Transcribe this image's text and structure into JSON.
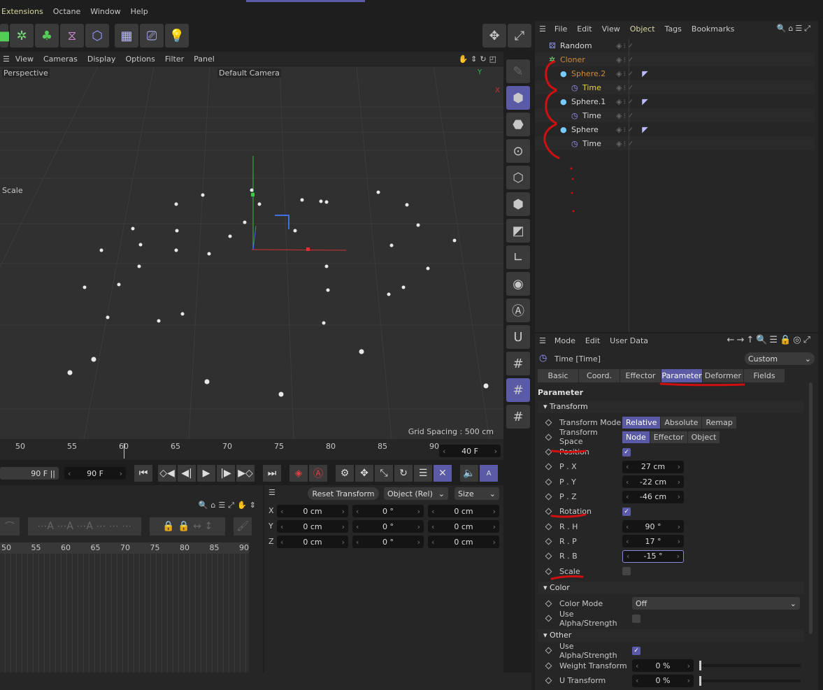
{
  "menubar": {
    "items": [
      "Extensions",
      "Octane",
      "Window",
      "Help"
    ]
  },
  "viewport": {
    "menu": [
      "View",
      "Cameras",
      "Display",
      "Options",
      "Filter",
      "Panel"
    ],
    "view_name": "Perspective",
    "camera": "Default Camera",
    "scale_label": "Scale",
    "grid_spacing": "Grid Spacing : 500 cm",
    "axis_y": "Y",
    "axis_x": "X"
  },
  "timeline": {
    "ruler": [
      "50",
      "55",
      "60",
      "65",
      "70",
      "75",
      "80",
      "85",
      "90"
    ],
    "current_frame": "40 F",
    "end_frame_a": "90 F",
    "end_frame_b": "90 F",
    "dope_ruler": [
      "50",
      "55",
      "60",
      "65",
      "70",
      "75",
      "80",
      "85",
      "90"
    ]
  },
  "coords": {
    "reset": "Reset Transform",
    "mode": "Object (Rel)",
    "size": "Size",
    "rows": [
      {
        "axis": "X",
        "p": "0 cm",
        "r": "0 °",
        "s": "0 cm"
      },
      {
        "axis": "Y",
        "p": "0 cm",
        "r": "0 °",
        "s": "0 cm"
      },
      {
        "axis": "Z",
        "p": "0 cm",
        "r": "0 °",
        "s": "0 cm"
      }
    ]
  },
  "object_manager": {
    "menu": [
      "File",
      "Edit",
      "View",
      "Object",
      "Tags",
      "Bookmarks"
    ],
    "active_menu": "Object",
    "objects": [
      {
        "name": "Random",
        "color": "#d8d8d8"
      },
      {
        "name": "Cloner",
        "color": "#d08a3a"
      },
      {
        "name": "Sphere.2",
        "color": "#d08a3a"
      },
      {
        "name": "Time",
        "color": "#e8d040"
      },
      {
        "name": "Sphere.1",
        "color": "#d8d8d8"
      },
      {
        "name": "Time",
        "color": "#d8d8d8"
      },
      {
        "name": "Sphere",
        "color": "#d8d8d8"
      },
      {
        "name": "Time",
        "color": "#d8d8d8"
      }
    ]
  },
  "attributes": {
    "menu": [
      "Mode",
      "Edit",
      "User Data"
    ],
    "object_title": "Time [Time]",
    "preset": "Custom",
    "tabs": [
      "Basic",
      "Coord.",
      "Effector",
      "Parameter",
      "Deformer",
      "Fields"
    ],
    "active_tab": "Parameter",
    "section_title": "Parameter",
    "transform": {
      "title": "Transform",
      "mode_label": "Transform Mode",
      "modes": [
        "Relative",
        "Absolute",
        "Remap"
      ],
      "space_label": "Transform Space",
      "spaces": [
        "Node",
        "Effector",
        "Object"
      ],
      "position_label": "Position",
      "position_checked": true,
      "px_label": "P . X",
      "px": "27 cm",
      "py_label": "P . Y",
      "py": "-22 cm",
      "pz_label": "P . Z",
      "pz": "-46 cm",
      "rotation_label": "Rotation",
      "rotation_checked": true,
      "rh_label": "R . H",
      "rh": "90 °",
      "rp_label": "R . P",
      "rp": "17 °",
      "rb_label": "R . B",
      "rb": "-15 °",
      "scale_label": "Scale",
      "scale_checked": false
    },
    "color": {
      "title": "Color",
      "mode_label": "Color Mode",
      "mode": "Off",
      "alpha_label": "Use Alpha/Strength",
      "alpha_checked": false
    },
    "other": {
      "title": "Other",
      "alpha_label": "Use Alpha/Strength",
      "alpha_checked": true,
      "weight_label": "Weight Transform",
      "weight": "0 %",
      "u_label": "U Transform",
      "u": "0 %"
    }
  },
  "colors": {
    "accent": "#5a5aa6",
    "annotation": "#d01010"
  }
}
